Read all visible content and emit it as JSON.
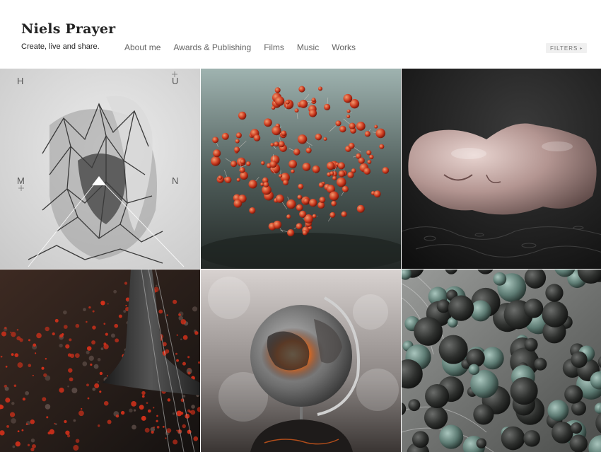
{
  "site": {
    "title": "Niels Prayer",
    "tagline": "Create, live and share."
  },
  "nav": {
    "items": [
      {
        "label": "About me"
      },
      {
        "label": "Awards & Publishing"
      },
      {
        "label": "Films"
      },
      {
        "label": "Music"
      },
      {
        "label": "Works"
      }
    ]
  },
  "filters": {
    "label": "FILTERS",
    "caret": "▸"
  },
  "grid": {
    "tile1": {
      "letters": [
        "H",
        "U",
        "M",
        "N"
      ]
    }
  }
}
